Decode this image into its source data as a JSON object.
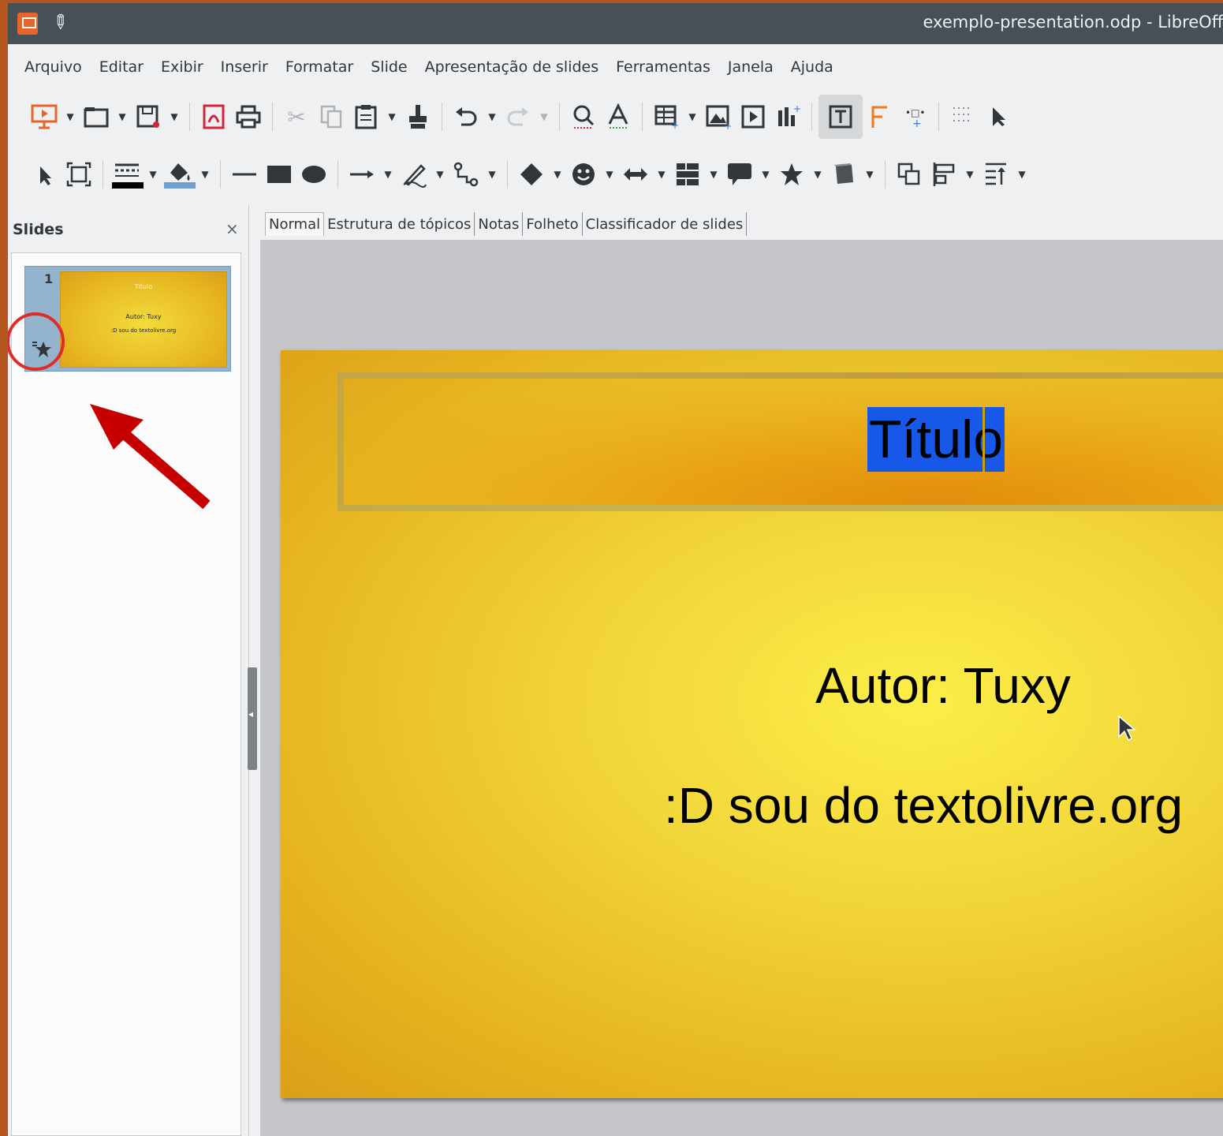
{
  "window": {
    "title": "exemplo-presentation.odp - LibreOffi"
  },
  "menubar": {
    "items": [
      "Arquivo",
      "Editar",
      "Exibir",
      "Inserir",
      "Formatar",
      "Slide",
      "Apresentação de slides",
      "Ferramentas",
      "Janela",
      "Ajuda"
    ]
  },
  "toolbar_standard": {
    "icons": [
      "start-slideshow-icon",
      "open-icon",
      "save-icon",
      "export-pdf-icon",
      "print-icon",
      "cut-icon",
      "copy-icon",
      "paste-icon",
      "clone-formatting-icon",
      "undo-icon",
      "redo-icon",
      "find-icon",
      "spelling-icon",
      "table-icon",
      "image-icon",
      "media-icon",
      "chart-icon",
      "text-box-icon",
      "fontwork-icon",
      "fields-icon",
      "grid-icon",
      "select-icon"
    ]
  },
  "toolbar_drawing": {
    "icons": [
      "select-icon",
      "zoom-pan-icon",
      "line-color-icon",
      "fill-color-icon",
      "line-icon",
      "rectangle-icon",
      "ellipse-icon",
      "arrow-line-icon",
      "curve-icon",
      "connector-icon",
      "basic-shapes-icon",
      "symbol-shapes-icon",
      "block-arrows-icon",
      "flowchart-icon",
      "callout-icon",
      "stars-icon",
      "3d-objects-icon",
      "transformations-icon",
      "align-icon",
      "arrange-icon"
    ]
  },
  "slides_panel": {
    "header": "Slides",
    "close": "×",
    "slides": [
      {
        "number": "1",
        "title": "Título",
        "author": "Autor: Tuxy",
        "subtitle": ":D sou do textolivre.org"
      }
    ]
  },
  "view_tabs": [
    "Normal",
    "Estrutura de tópicos",
    "Notas",
    "Folheto",
    "Classificador de slides"
  ],
  "slide": {
    "title": "Título",
    "author": "Autor: Tuxy",
    "subtitle": ":D sou do textolivre.org"
  },
  "colors": {
    "highlight_circle": "#e02b2b",
    "arrow": "#c60000",
    "selection": "#1758e8"
  }
}
